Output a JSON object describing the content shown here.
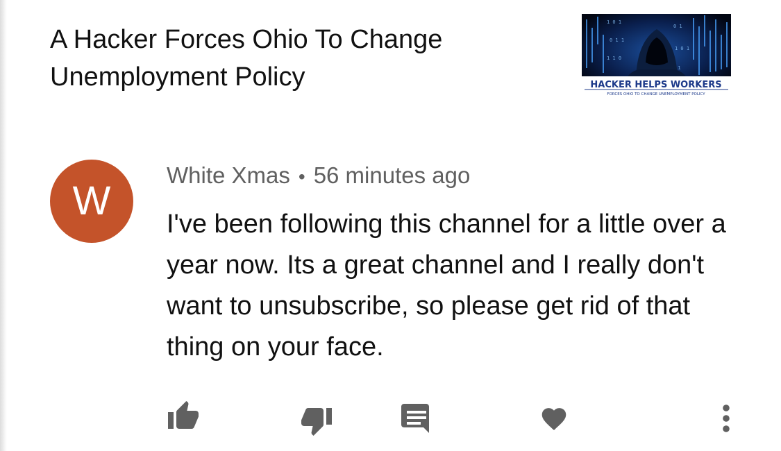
{
  "video": {
    "title": "A Hacker Forces Ohio To Change Unemployment Policy",
    "thumbnail": {
      "headline": "HACKER HELPS WORKERS",
      "subline": "FORCES OHIO TO CHANGE UNEMPLOYMENT POLICY"
    }
  },
  "comment": {
    "avatar_letter": "W",
    "avatar_color": "#c4532a",
    "author": "White Xmas",
    "separator": "•",
    "timestamp": "56 minutes ago",
    "text": "I've been following this channel for a little over a year now. Its a great channel and I really don't want to unsubscribe, so please get rid of that thing on your face."
  },
  "actions": {
    "icons": [
      "thumbs-up-icon",
      "thumbs-down-icon",
      "reply-icon",
      "heart-icon",
      "more-vert-icon"
    ],
    "icon_color": "#606060"
  }
}
